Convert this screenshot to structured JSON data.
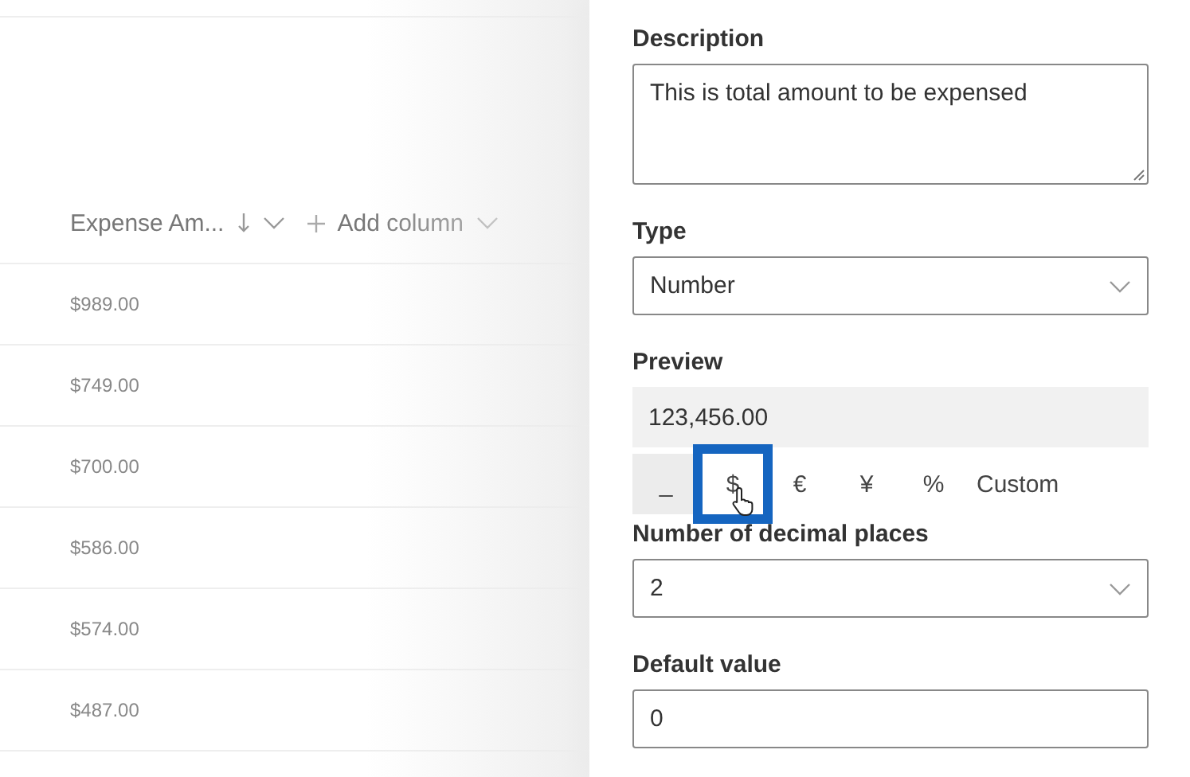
{
  "list": {
    "columns": [
      {
        "label": "Expense Am...",
        "sorted": true
      },
      {
        "label": "Add column",
        "kind": "add"
      }
    ],
    "rows": [
      "$989.00",
      "$749.00",
      "$700.00",
      "$586.00",
      "$574.00",
      "$487.00"
    ]
  },
  "panel": {
    "description": {
      "label": "Description",
      "value": "This is total amount to be expensed"
    },
    "type": {
      "label": "Type",
      "value": "Number"
    },
    "preview": {
      "label": "Preview",
      "value": "123,456.00"
    },
    "formats": [
      {
        "label": "_",
        "selected": true
      },
      {
        "label": "$",
        "selected": false,
        "highlighted": true
      },
      {
        "label": "€",
        "selected": false
      },
      {
        "label": "¥",
        "selected": false
      },
      {
        "label": "%",
        "selected": false
      },
      {
        "label": "Custom",
        "selected": false
      }
    ],
    "decimals": {
      "label": "Number of decimal places",
      "value": "2"
    },
    "default_value": {
      "label": "Default value",
      "value": "0"
    }
  }
}
